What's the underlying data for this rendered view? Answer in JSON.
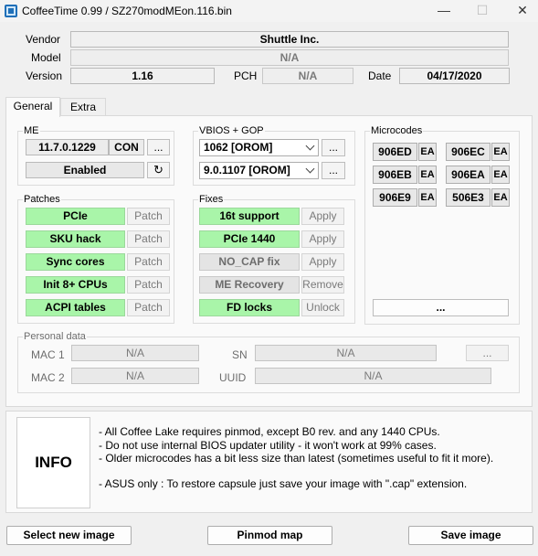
{
  "window": {
    "title": "CoffeeTime 0.99  /  SZ270modMEon.116.bin",
    "minimize": "—",
    "maximize": "☐",
    "close": "✕"
  },
  "info": {
    "vendor_label": "Vendor",
    "vendor": "Shuttle Inc.",
    "model_label": "Model",
    "model": "N/A",
    "version_label": "Version",
    "version": "1.16",
    "pch_label": "PCH",
    "pch": "N/A",
    "date_label": "Date",
    "date": "04/17/2020"
  },
  "tabs": [
    {
      "label": "General",
      "active": true
    },
    {
      "label": "Extra",
      "active": false
    }
  ],
  "me": {
    "title": "ME",
    "version": "11.7.0.1229",
    "type": "CON",
    "more": "...",
    "state": "Enabled",
    "refresh_icon": "↻"
  },
  "vbios": {
    "title": "VBIOS + GOP",
    "vbios_value": "1062 [OROM]",
    "gop_value": "9.0.1107 [OROM]",
    "more1": "...",
    "more2": "..."
  },
  "microcodes": {
    "title": "Microcodes",
    "items": [
      {
        "id": "906ED",
        "tag": "EA"
      },
      {
        "id": "906EC",
        "tag": "EA"
      },
      {
        "id": "906EB",
        "tag": "EA"
      },
      {
        "id": "906EA",
        "tag": "EA"
      },
      {
        "id": "906E9",
        "tag": "EA"
      },
      {
        "id": "506E3",
        "tag": "EA"
      }
    ],
    "more": "..."
  },
  "patches": {
    "title": "Patches",
    "items": [
      {
        "name": "PCIe",
        "action": "Patch"
      },
      {
        "name": "SKU hack",
        "action": "Patch"
      },
      {
        "name": "Sync cores",
        "action": "Patch"
      },
      {
        "name": "Init 8+ CPUs",
        "action": "Patch"
      },
      {
        "name": "ACPI tables",
        "action": "Patch"
      }
    ]
  },
  "fixes": {
    "title": "Fixes",
    "items": [
      {
        "name": "16t support",
        "action": "Apply"
      },
      {
        "name": "PCIe 1440",
        "action": "Apply"
      },
      {
        "name": "NO_CAP fix",
        "action": "Apply"
      },
      {
        "name": "ME Recovery",
        "action": "Remove"
      },
      {
        "name": "FD locks",
        "action": "Unlock"
      }
    ]
  },
  "personal": {
    "title": "Personal data",
    "mac1_label": "MAC 1",
    "mac1": "N/A",
    "mac2_label": "MAC 2",
    "mac2": "N/A",
    "sn_label": "SN",
    "sn": "N/A",
    "uuid_label": "UUID",
    "uuid": "N/A",
    "more": "..."
  },
  "notes": {
    "label": "INFO",
    "lines": [
      "- All Coffee Lake requires pinmod, except B0 rev. and any 1440 CPUs.",
      "- Do not use internal BIOS updater utility - it won't work at 99% cases.",
      "- Older microcodes has a bit less size than latest (sometimes useful to fit it more).",
      "- ASUS only : To restore capsule just save your image with \".cap\" extension."
    ]
  },
  "actions": {
    "select": "Select new image",
    "pinmod": "Pinmod map",
    "save": "Save image"
  },
  "colors": {
    "enabled_green": "#a9f5a9",
    "window_bg": "#f0f0f0",
    "panel_bg": "#fafafa"
  }
}
